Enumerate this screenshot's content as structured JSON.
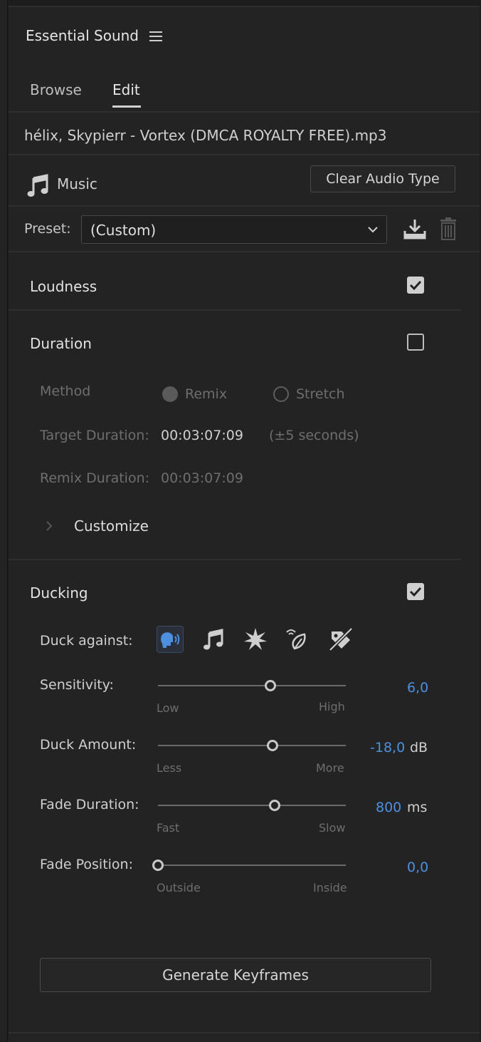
{
  "panel": {
    "title": "Essential Sound",
    "tabs": [
      {
        "label": "Browse"
      },
      {
        "label": "Edit"
      }
    ],
    "active_tab": "Edit"
  },
  "clip": {
    "filename": "hélix, Skypierr - Vortex (DMCA  ROYALTY FREE).mp3",
    "audio_type": "Music",
    "clear_button": "Clear Audio Type"
  },
  "preset": {
    "label": "Preset:",
    "value": "(Custom)"
  },
  "loudness": {
    "title": "Loudness",
    "checked": true
  },
  "duration": {
    "title": "Duration",
    "checked": false,
    "method_label": "Method",
    "method_options": [
      "Remix",
      "Stretch"
    ],
    "method_selected": "Remix",
    "target_label": "Target Duration:",
    "target_value": "00:03:07:09",
    "target_hint": "(±5 seconds)",
    "remix_label": "Remix Duration:",
    "remix_value": "00:03:07:09",
    "customize_label": "Customize"
  },
  "ducking": {
    "title": "Ducking",
    "checked": true,
    "duck_against_label": "Duck against:",
    "duck_against_icons": [
      "dialogue-icon",
      "music-icon",
      "sfx-icon",
      "ambience-icon",
      "untagged-icon"
    ],
    "duck_against_selected": "dialogue-icon",
    "sliders": [
      {
        "label": "Sensitivity:",
        "min_label": "Low",
        "max_label": "High",
        "value": "6,0",
        "unit": "",
        "level": 0.6
      },
      {
        "label": "Duck Amount:",
        "min_label": "Less",
        "max_label": "More",
        "value": "-18,0",
        "unit": "dB",
        "level": 0.61
      },
      {
        "label": "Fade Duration:",
        "min_label": "Fast",
        "max_label": "Slow",
        "value": "800",
        "unit": "ms",
        "level": 0.62
      },
      {
        "label": "Fade Position:",
        "min_label": "Outside",
        "max_label": "Inside",
        "value": "0,0",
        "unit": "",
        "level": 0.0
      }
    ],
    "generate_button": "Generate Keyframes"
  },
  "colors": {
    "accent": "#4d8fe0",
    "panel_bg": "#232323"
  }
}
